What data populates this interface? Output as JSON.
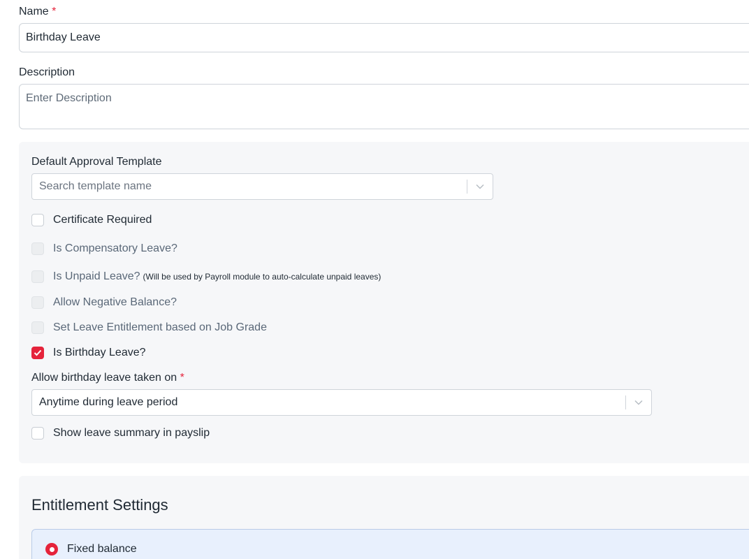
{
  "name_field": {
    "label": "Name",
    "required_mark": "*",
    "value": "Birthday Leave"
  },
  "description_field": {
    "label": "Description",
    "placeholder": "Enter Description"
  },
  "approval_template": {
    "label": "Default Approval Template",
    "placeholder": "Search template name"
  },
  "options": [
    {
      "label": "Certificate Required",
      "note": "",
      "checked": false,
      "disabled": false
    },
    {
      "label": "Is Compensatory Leave?",
      "note": "",
      "checked": false,
      "disabled": true
    },
    {
      "label": "Is Unpaid Leave?",
      "note": "(Will be used by Payroll module to auto-calculate unpaid leaves)",
      "checked": false,
      "disabled": true
    },
    {
      "label": "Allow Negative Balance?",
      "note": "",
      "checked": false,
      "disabled": true
    },
    {
      "label": "Set Leave Entitlement based on Job Grade",
      "note": "",
      "checked": false,
      "disabled": true
    },
    {
      "label": "Is Birthday Leave?",
      "note": "",
      "checked": true,
      "disabled": false
    }
  ],
  "birthday_taken_on": {
    "label": "Allow birthday leave taken on",
    "required_mark": "*",
    "value": "Anytime during leave period"
  },
  "payslip_option": {
    "label": "Show leave summary in payslip",
    "checked": false
  },
  "entitlement": {
    "title": "Entitlement Settings",
    "selected_option": "Fixed balance"
  },
  "colors": {
    "accent": "#e5233b",
    "panel_bg": "#f6f7f9",
    "selected_card_bg": "#e8f0fd"
  }
}
